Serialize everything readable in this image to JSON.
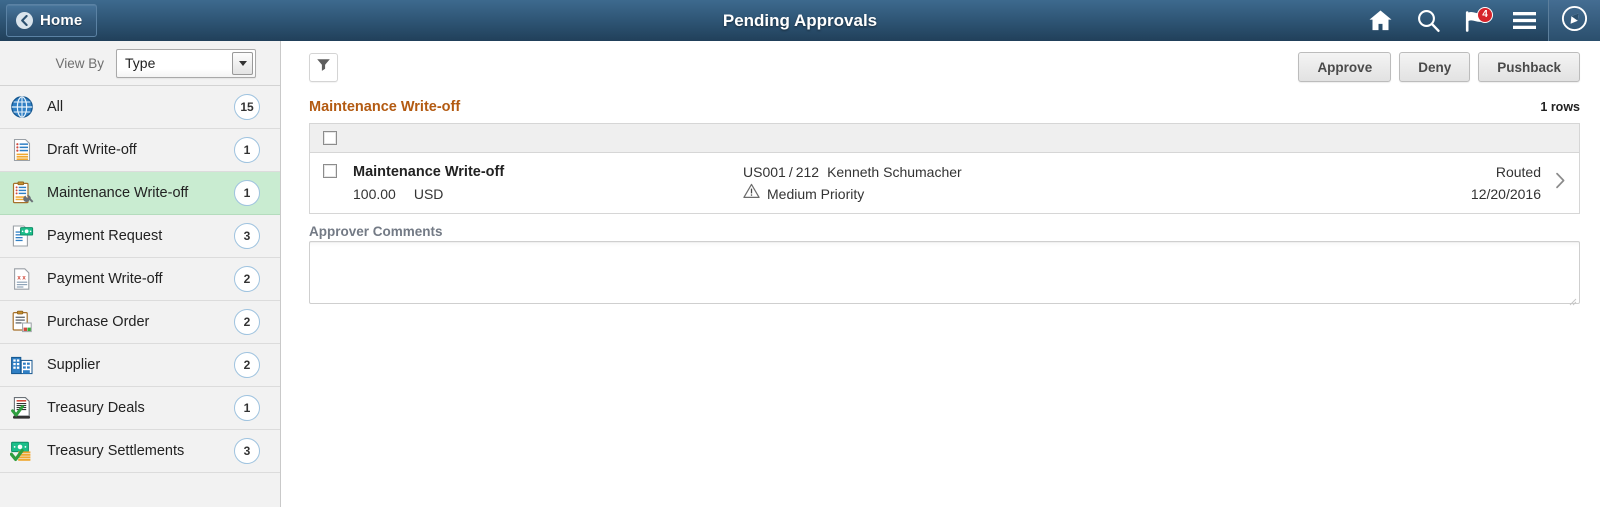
{
  "header": {
    "home_label": "Home",
    "title": "Pending Approvals",
    "icons": {
      "home": "home-icon",
      "search": "search-icon",
      "notifications": "flag-notification-icon",
      "notifications_badge": "4",
      "menu": "hamburger-menu-icon",
      "navbar": "navbar-compass-icon"
    }
  },
  "sidebar": {
    "view_by_label": "View By",
    "view_by_value": "Type",
    "items": [
      {
        "label": "All",
        "count": "15",
        "icon": "globe-icon",
        "selected": false
      },
      {
        "label": "Draft Write-off",
        "count": "1",
        "icon": "document-list-icon",
        "selected": false
      },
      {
        "label": "Maintenance Write-off",
        "count": "1",
        "icon": "clipboard-wrench-icon",
        "selected": true
      },
      {
        "label": "Payment Request",
        "count": "3",
        "icon": "document-money-icon",
        "selected": false
      },
      {
        "label": "Payment Write-off",
        "count": "2",
        "icon": "document-x-icon",
        "selected": false
      },
      {
        "label": "Purchase Order",
        "count": "2",
        "icon": "clipboard-order-icon",
        "selected": false
      },
      {
        "label": "Supplier",
        "count": "2",
        "icon": "buildings-icon",
        "selected": false
      },
      {
        "label": "Treasury Deals",
        "count": "1",
        "icon": "document-check-icon",
        "selected": false
      },
      {
        "label": "Treasury Settlements",
        "count": "3",
        "icon": "money-check-icon",
        "selected": false
      }
    ]
  },
  "toolbar": {
    "filter_icon": "filter-funnel-icon",
    "approve_label": "Approve",
    "deny_label": "Deny",
    "pushback_label": "Pushback"
  },
  "content": {
    "group_title": "Maintenance Write-off",
    "rows_count": "1 rows",
    "rows": [
      {
        "title": "Maintenance Write-off",
        "amount": "100.00",
        "currency": "USD",
        "business_unit": "US001",
        "separator": "/",
        "doc_id": "212",
        "requester": "Kenneth Schumacher",
        "priority": "Medium Priority",
        "priority_icon": "warning-triangle-icon",
        "status": "Routed",
        "date": "12/20/2016",
        "chevron": "chevron-right-icon"
      }
    ]
  },
  "comments": {
    "label": "Approver Comments",
    "value": "",
    "placeholder": ""
  },
  "colors": {
    "header_top": "#3d6a8e",
    "header_bottom": "#21405a",
    "badge_red": "#d6232b",
    "group_title_orange": "#b35a11",
    "selected_green": "#c9ecd1",
    "sidebar_bg": "#f2f2f2"
  }
}
